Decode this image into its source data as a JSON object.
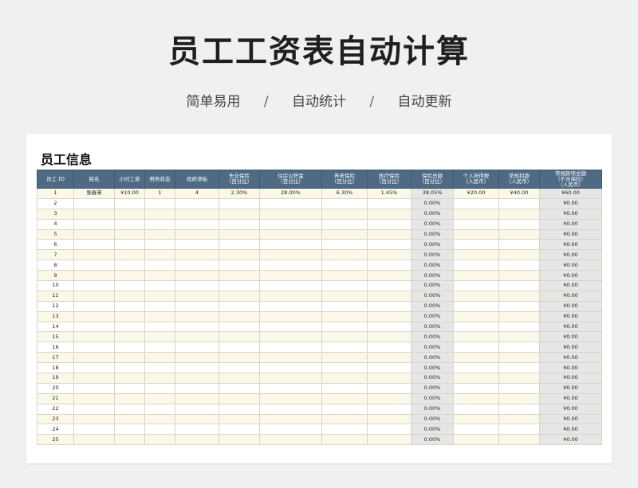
{
  "hero": {
    "title": "员工工资表自动计算"
  },
  "subtitle": {
    "items": [
      "简单易用",
      "自动统计",
      "自动更新"
    ],
    "separator": "/"
  },
  "sheet": {
    "title": "员工信息",
    "columns": [
      "员工 ID",
      "姓名",
      "小时工资",
      "税务状态",
      "政府津贴",
      "失业保险\n（百分比）",
      "住房公积金\n（百分比）",
      "养老保险\n（百分比）",
      "医疗保险\n（百分比）",
      "保险总额\n（百分比）",
      "个人所得税\n（人民币）",
      "常规扣款\n（人民币）",
      "常规款项总额\n（不含保险）\n（人民币）"
    ],
    "rows": [
      [
        "1",
        "张春来",
        "¥10.00",
        "1",
        "4",
        "2.30%",
        "28.00%",
        "6.30%",
        "1.45%",
        "38.05%",
        "¥20.00",
        "¥40.00",
        "¥60.00"
      ],
      [
        "2",
        "",
        "",
        "",
        "",
        "",
        "",
        "",
        "",
        "0.00%",
        "",
        "",
        "¥0.00"
      ],
      [
        "3",
        "",
        "",
        "",
        "",
        "",
        "",
        "",
        "",
        "0.00%",
        "",
        "",
        "¥0.00"
      ],
      [
        "4",
        "",
        "",
        "",
        "",
        "",
        "",
        "",
        "",
        "0.00%",
        "",
        "",
        "¥0.00"
      ],
      [
        "5",
        "",
        "",
        "",
        "",
        "",
        "",
        "",
        "",
        "0.00%",
        "",
        "",
        "¥0.00"
      ],
      [
        "6",
        "",
        "",
        "",
        "",
        "",
        "",
        "",
        "",
        "0.00%",
        "",
        "",
        "¥0.00"
      ],
      [
        "7",
        "",
        "",
        "",
        "",
        "",
        "",
        "",
        "",
        "0.00%",
        "",
        "",
        "¥0.00"
      ],
      [
        "8",
        "",
        "",
        "",
        "",
        "",
        "",
        "",
        "",
        "0.00%",
        "",
        "",
        "¥0.00"
      ],
      [
        "9",
        "",
        "",
        "",
        "",
        "",
        "",
        "",
        "",
        "0.00%",
        "",
        "",
        "¥0.00"
      ],
      [
        "10",
        "",
        "",
        "",
        "",
        "",
        "",
        "",
        "",
        "0.00%",
        "",
        "",
        "¥0.00"
      ],
      [
        "11",
        "",
        "",
        "",
        "",
        "",
        "",
        "",
        "",
        "0.00%",
        "",
        "",
        "¥0.00"
      ],
      [
        "12",
        "",
        "",
        "",
        "",
        "",
        "",
        "",
        "",
        "0.00%",
        "",
        "",
        "¥0.00"
      ],
      [
        "13",
        "",
        "",
        "",
        "",
        "",
        "",
        "",
        "",
        "0.00%",
        "",
        "",
        "¥0.00"
      ],
      [
        "14",
        "",
        "",
        "",
        "",
        "",
        "",
        "",
        "",
        "0.00%",
        "",
        "",
        "¥0.00"
      ],
      [
        "15",
        "",
        "",
        "",
        "",
        "",
        "",
        "",
        "",
        "0.00%",
        "",
        "",
        "¥0.00"
      ],
      [
        "16",
        "",
        "",
        "",
        "",
        "",
        "",
        "",
        "",
        "0.00%",
        "",
        "",
        "¥0.00"
      ],
      [
        "17",
        "",
        "",
        "",
        "",
        "",
        "",
        "",
        "",
        "0.00%",
        "",
        "",
        "¥0.00"
      ],
      [
        "18",
        "",
        "",
        "",
        "",
        "",
        "",
        "",
        "",
        "0.00%",
        "",
        "",
        "¥0.00"
      ],
      [
        "19",
        "",
        "",
        "",
        "",
        "",
        "",
        "",
        "",
        "0.00%",
        "",
        "",
        "¥0.00"
      ],
      [
        "20",
        "",
        "",
        "",
        "",
        "",
        "",
        "",
        "",
        "0.00%",
        "",
        "",
        "¥0.00"
      ],
      [
        "21",
        "",
        "",
        "",
        "",
        "",
        "",
        "",
        "",
        "0.00%",
        "",
        "",
        "¥0.00"
      ],
      [
        "22",
        "",
        "",
        "",
        "",
        "",
        "",
        "",
        "",
        "0.00%",
        "",
        "",
        "¥0.00"
      ],
      [
        "23",
        "",
        "",
        "",
        "",
        "",
        "",
        "",
        "",
        "0.00%",
        "",
        "",
        "¥0.00"
      ],
      [
        "24",
        "",
        "",
        "",
        "",
        "",
        "",
        "",
        "",
        "0.00%",
        "",
        "",
        "¥0.00"
      ],
      [
        "25",
        "",
        "",
        "",
        "",
        "",
        "",
        "",
        "",
        "0.00%",
        "",
        "",
        "¥0.00"
      ]
    ]
  },
  "colors": {
    "header_bg": "#4e6a85",
    "row_alt": "#fbf8ea",
    "calc_bg": "#e6e6e6"
  }
}
